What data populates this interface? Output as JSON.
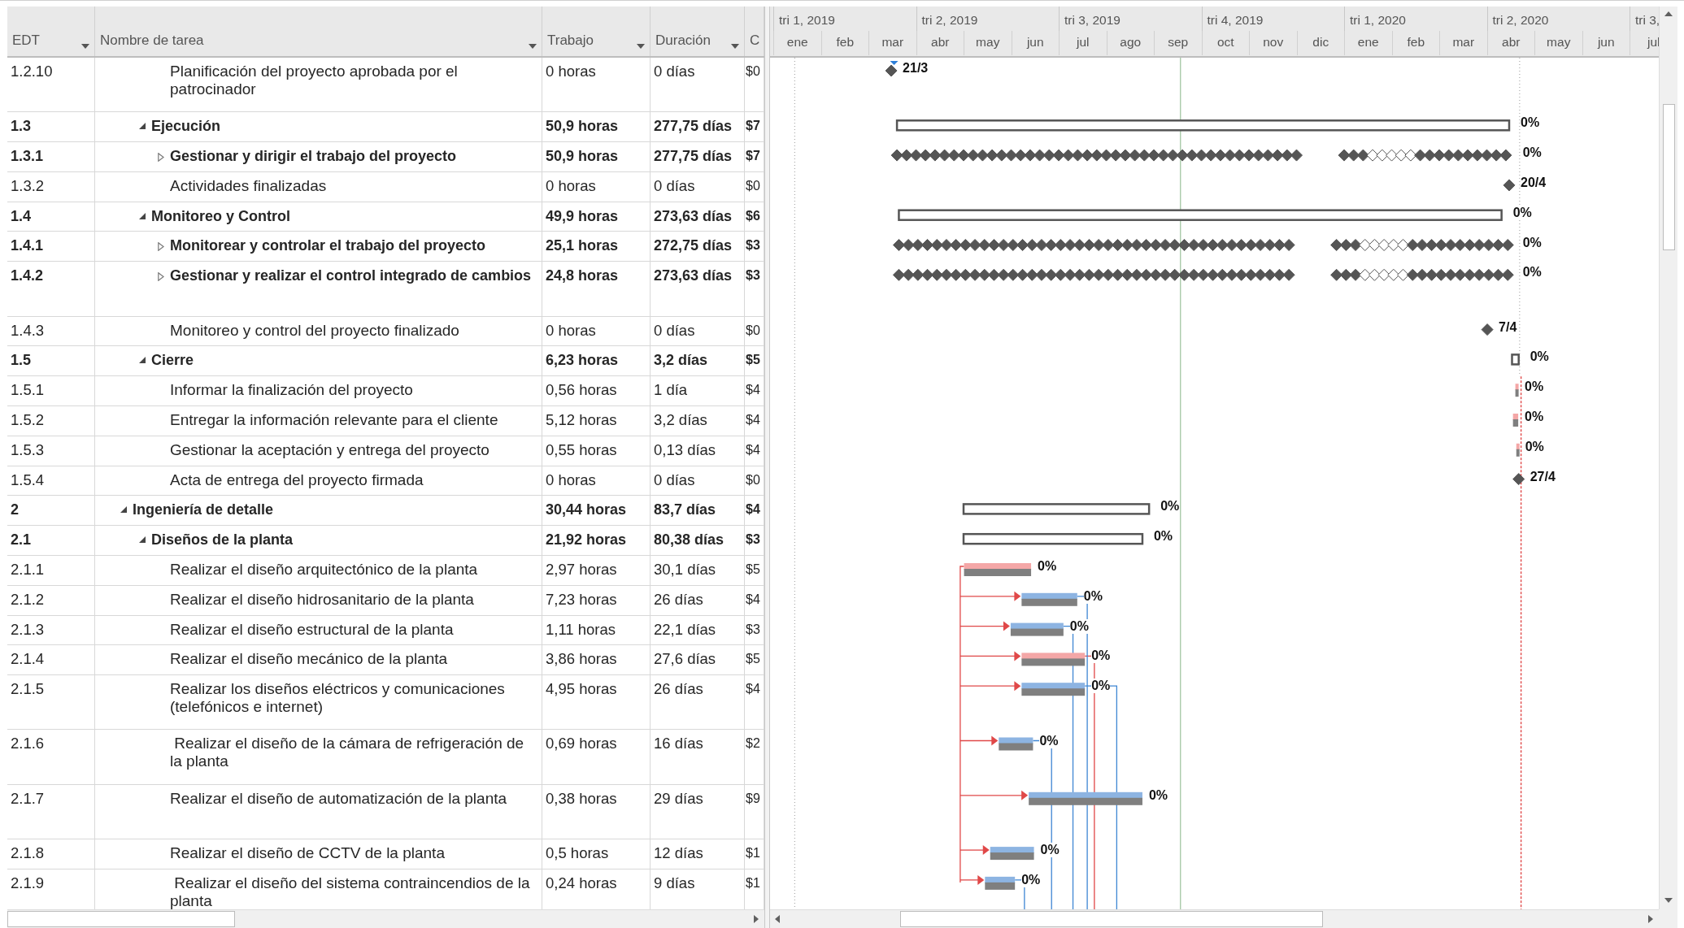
{
  "table": {
    "columns": [
      {
        "label": "EDT",
        "filter": true
      },
      {
        "label": "Nombre de tarea",
        "filter": true
      },
      {
        "label": "Trabajo",
        "filter": true
      },
      {
        "label": "Duración",
        "filter": true
      },
      {
        "label": "C",
        "filter": false
      }
    ]
  },
  "timescale": {
    "quarters": [
      "tri 1, 2019",
      "tri 2, 2019",
      "tri 3, 2019",
      "tri 4, 2019",
      "tri 1, 2020",
      "tri 2, 2020",
      "tri 3,"
    ],
    "months": [
      "ene",
      "feb",
      "mar",
      "abr",
      "may",
      "jun",
      "jul",
      "ago",
      "sep",
      "oct",
      "nov",
      "dic",
      "ene",
      "feb",
      "mar",
      "abr",
      "may",
      "jun",
      "jul"
    ]
  },
  "outline": [
    {
      "children": [
        {
          "children": [
            {
              "edt": "1.2.10",
              "name": "Planificación del proyecto aprobada por el patrocinador",
              "work": "0 horas",
              "duration": "0 días",
              "cost": "$0",
              "kind": "milestone",
              "bar_label": "21/3"
            }
          ]
        },
        {
          "edt": "1.3",
          "name": "Ejecución",
          "work": "50,9 horas",
          "duration": "277,75 días",
          "cost": "$7",
          "kind": "summary",
          "expanded": true,
          "bar_label": "0%",
          "children": [
            {
              "edt": "1.3.1",
              "name": "Gestionar y dirigir el trabajo del proyecto",
              "work": "50,9 horas",
              "duration": "277,75 días",
              "cost": "$7",
              "kind": "recurring",
              "expanded": false,
              "bar_label": "0%"
            },
            {
              "edt": "1.3.2",
              "name": "Actividades finalizadas",
              "work": "0 horas",
              "duration": "0 días",
              "cost": "$0",
              "kind": "milestone",
              "bar_label": "20/4"
            }
          ]
        },
        {
          "edt": "1.4",
          "name": "Monitoreo y Control",
          "work": "49,9 horas",
          "duration": "273,63 días",
          "cost": "$6",
          "kind": "summary",
          "expanded": true,
          "bar_label": "0%",
          "children": [
            {
              "edt": "1.4.1",
              "name": "Monitorear y controlar el trabajo del proyecto",
              "work": "25,1 horas",
              "duration": "272,75 días",
              "cost": "$3",
              "kind": "recurring",
              "expanded": false,
              "bar_label": "0%"
            },
            {
              "edt": "1.4.2",
              "name": "Gestionar y realizar el control integrado de cambios",
              "work": "24,8 horas",
              "duration": "273,63 días",
              "cost": "$3",
              "kind": "recurring",
              "expanded": false,
              "bar_label": "0%"
            },
            {
              "edt": "1.4.3",
              "name": "Monitoreo y control del proyecto finalizado",
              "work": "0 horas",
              "duration": "0 días",
              "cost": "$0",
              "kind": "milestone",
              "bar_label": "7/4"
            }
          ]
        },
        {
          "edt": "1.5",
          "name": "Cierre",
          "work": "6,23 horas",
          "duration": "3,2 días",
          "cost": "$5",
          "kind": "summary",
          "expanded": true,
          "bar_label": "0%",
          "children": [
            {
              "edt": "1.5.1",
              "name": "Informar la finalización del proyecto",
              "work": "0,56 horas",
              "duration": "1 día",
              "cost": "$4",
              "kind": "task",
              "critical": true,
              "bar_label": "0%"
            },
            {
              "edt": "1.5.2",
              "name": "Entregar la información relevante para el cliente",
              "work": "5,12 horas",
              "duration": "3,2 días",
              "cost": "$4",
              "kind": "task",
              "critical": true,
              "bar_label": "0%"
            },
            {
              "edt": "1.5.3",
              "name": "Gestionar la aceptación y entrega del proyecto",
              "work": "0,55 horas",
              "duration": "0,13 días",
              "cost": "$4",
              "kind": "task",
              "critical": true,
              "bar_label": "0%"
            },
            {
              "edt": "1.5.4",
              "name": "Acta de entrega del proyecto firmada",
              "work": "0 horas",
              "duration": "0 días",
              "cost": "$0",
              "kind": "milestone",
              "bar_label": "27/4"
            }
          ]
        }
      ]
    },
    {
      "edt": "2",
      "name": "Ingeniería de detalle",
      "work": "30,44 horas",
      "duration": "83,7 días",
      "cost": "$4",
      "kind": "summary",
      "expanded": true,
      "bar_label": "0%",
      "children": [
        {
          "edt": "2.1",
          "name": "Diseños de la planta",
          "work": "21,92 horas",
          "duration": "80,38 días",
          "cost": "$3",
          "kind": "summary",
          "expanded": true,
          "bar_label": "0%",
          "children": [
            {
              "edt": "2.1.1",
              "name": "Realizar el diseño arquitectónico de la planta",
              "work": "2,97 horas",
              "duration": "30,1 días",
              "cost": "$5",
              "kind": "task",
              "critical": true,
              "bar_label": "0%"
            },
            {
              "edt": "2.1.2",
              "name": "Realizar el diseño hidrosanitario de la planta",
              "work": "7,23 horas",
              "duration": "26 días",
              "cost": "$4",
              "kind": "task",
              "critical": false,
              "bar_label": "0%"
            },
            {
              "edt": "2.1.3",
              "name": "Realizar el diseño estructural de la planta",
              "work": "1,11 horas",
              "duration": "22,1 días",
              "cost": "$3",
              "kind": "task",
              "critical": false,
              "bar_label": "0%"
            },
            {
              "edt": "2.1.4",
              "name": "Realizar el diseño mecánico de la planta",
              "work": "3,86 horas",
              "duration": "27,6 días",
              "cost": "$5",
              "kind": "task",
              "critical": true,
              "bar_label": "0%"
            },
            {
              "edt": "2.1.5",
              "name": "Realizar los diseños eléctricos y comunicaciones (telefónicos e internet)",
              "work": "4,95 horas",
              "duration": "26 días",
              "cost": "$4",
              "kind": "task",
              "critical": false,
              "bar_label": "0%"
            },
            {
              "edt": "2.1.6",
              "name": " Realizar el diseño de la cámara de refrigeración de la planta",
              "work": "0,69 horas",
              "duration": "16 días",
              "cost": "$2",
              "kind": "task",
              "critical": false,
              "bar_label": "0%"
            },
            {
              "edt": "2.1.7",
              "name": "Realizar el diseño de automatización de la planta",
              "work": "0,38 horas",
              "duration": "29 días",
              "cost": "$9",
              "kind": "task",
              "critical": false,
              "bar_label": "0%"
            },
            {
              "edt": "2.1.8",
              "name": "Realizar el diseño de CCTV de la planta",
              "work": "0,5 horas",
              "duration": "12 días",
              "cost": "$1",
              "kind": "task",
              "critical": false,
              "bar_label": "0%"
            },
            {
              "edt": "2.1.9",
              "name": " Realizar el diseño del sistema contraincendios de la planta",
              "work": "0,24 horas",
              "duration": "9 días",
              "cost": "$1",
              "kind": "task",
              "critical": false,
              "bar_label": "0%"
            }
          ]
        }
      ]
    }
  ]
}
